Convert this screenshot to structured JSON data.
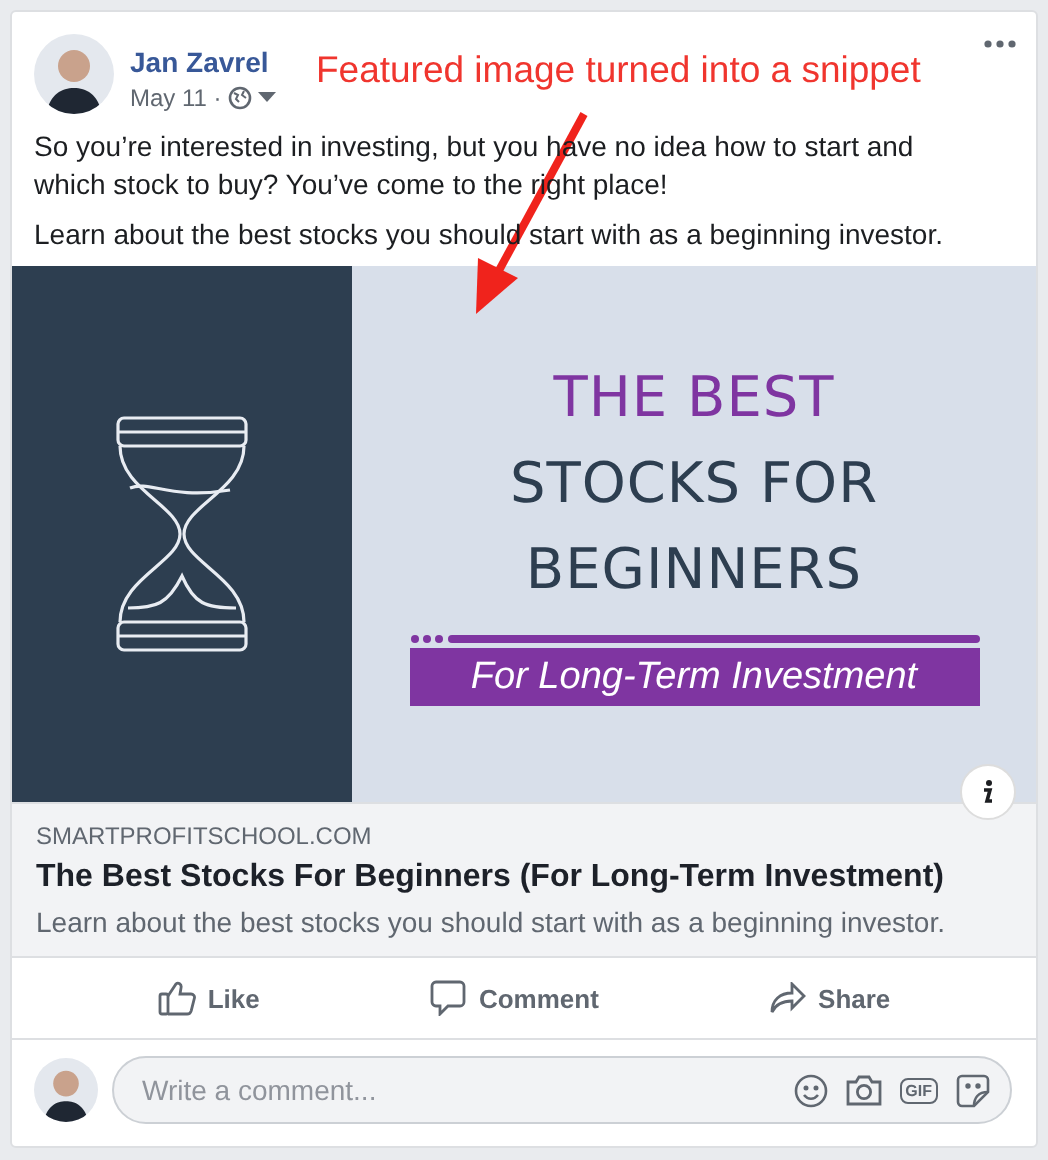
{
  "post": {
    "author": "Jan Zavrel",
    "date": "May 11 ·",
    "paragraphs": [
      "So you’re interested in investing, but you have no idea how to start and which stock to buy? You’ve come to the right place!",
      "Learn about the best stocks you should start with as a beginning investor."
    ]
  },
  "annotation": {
    "text": "Featured image turned into a snippet"
  },
  "link_image": {
    "title_top": "THE BEST",
    "title_lines": [
      "STOCKS FOR",
      "BEGINNERS"
    ],
    "banner": "For Long-Term Investment"
  },
  "link": {
    "domain": "SMARTPROFITSCHOOL.COM",
    "title": "The Best Stocks For Beginners (For Long-Term Investment)",
    "description": "Learn about the best stocks you should start with as a beginning investor."
  },
  "actions": [
    {
      "kind": "like",
      "label": "Like"
    },
    {
      "kind": "comment",
      "label": "Comment"
    },
    {
      "kind": "share",
      "label": "Share"
    }
  ],
  "comment_box": {
    "placeholder": "Write a comment...",
    "gif_label": "GIF"
  }
}
